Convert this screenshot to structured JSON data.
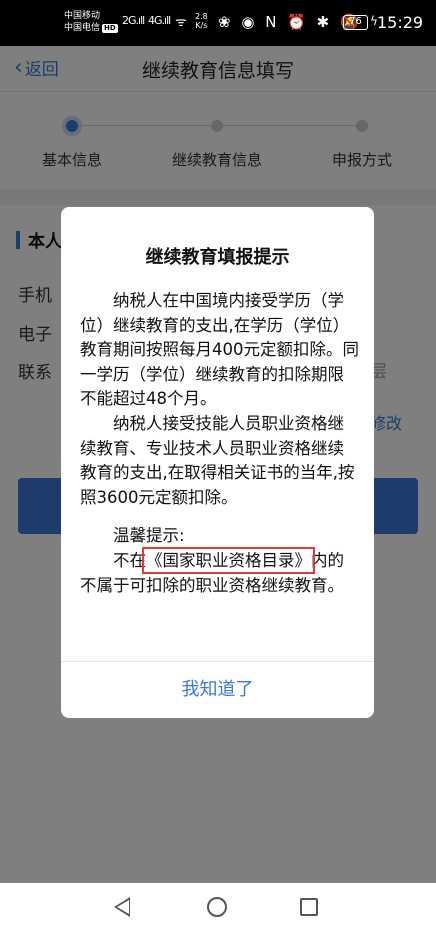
{
  "statusbar": {
    "carrier1": "中国移动",
    "carrier2": "中国电信",
    "hd": "HD",
    "sig1": "2G.ıll",
    "sig2": "4G.ıll",
    "wifi": "ᯤ",
    "speed_value": "2.8",
    "speed_unit": "K/s",
    "status_icons": "❀ ◉ N ⏰ ✱ 🔕",
    "battery": "76",
    "time": "15:29"
  },
  "header": {
    "back_label": "返回",
    "title": "继续教育信息填写"
  },
  "stepper": {
    "steps": [
      {
        "label": "基本信息"
      },
      {
        "label": "继续教育信息"
      },
      {
        "label": "申报方式"
      }
    ]
  },
  "form": {
    "section_title": "本人",
    "rows": [
      {
        "label": "手机"
      },
      {
        "label": "电子"
      },
      {
        "label": "联系"
      }
    ],
    "fade_text": "层",
    "modify_link": "修改"
  },
  "dialog": {
    "title": "继续教育填报提示",
    "para1": "纳税人在中国境内接受学历（学位）继续教育的支出,在学历（学位）教育期间按照每月400元定额扣除。同一学历（学位）继续教育的扣除期限不能超过48个月。",
    "para2": "纳税人接受技能人员职业资格继续教育、专业技术人员职业资格继续教育的支出,在取得相关证书的当年,按照3600元定额扣除。",
    "tip_title": "温馨提示:",
    "tip_pre": "不在",
    "tip_highlight": "《国家职业资格目录》",
    "tip_post": "内的不属于可扣除的职业资格继续教育。",
    "confirm_label": "我知道了"
  },
  "colors": {
    "accent": "#3a78d6",
    "highlight_border": "#e23a3a"
  }
}
